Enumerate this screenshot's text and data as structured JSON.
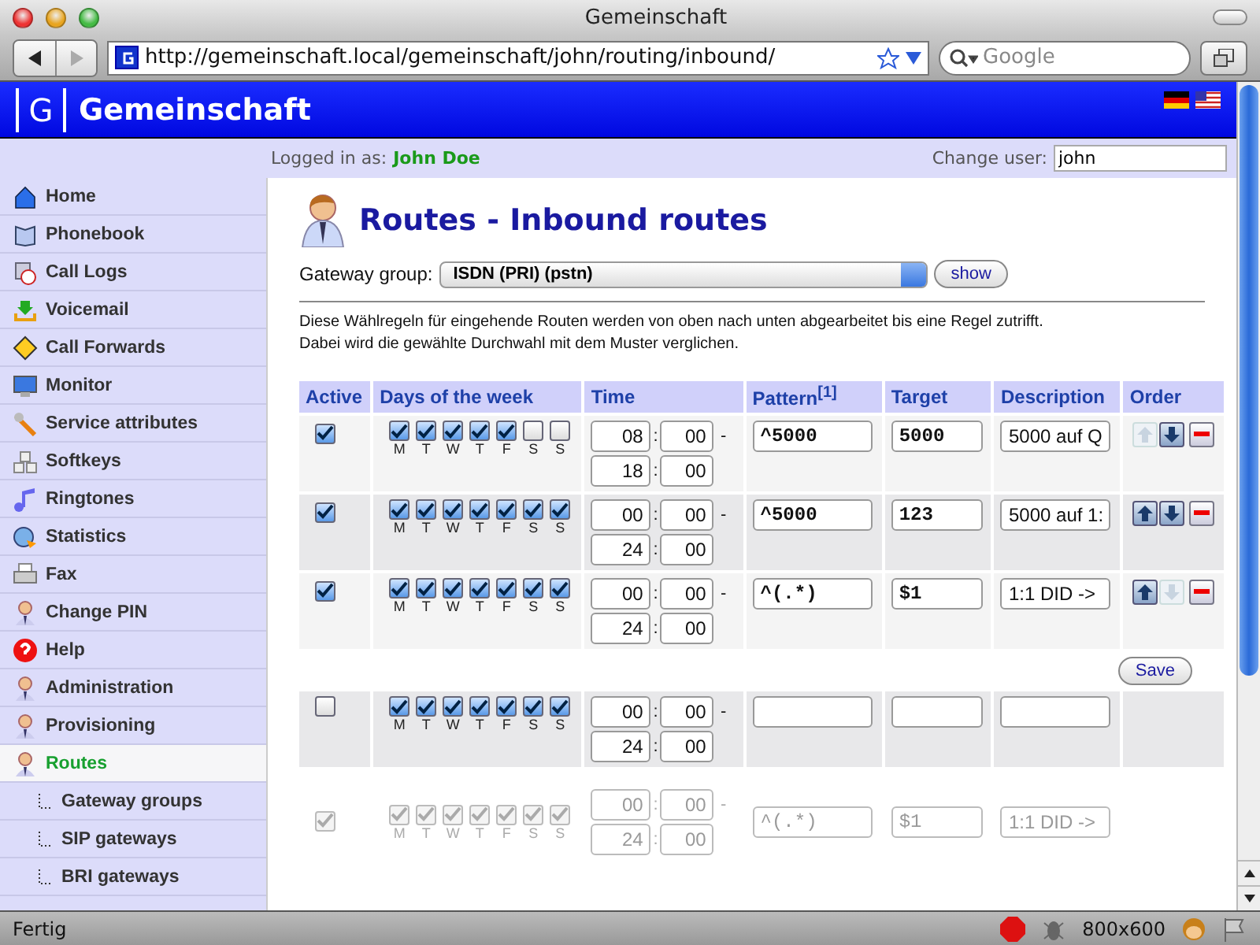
{
  "window": {
    "title": "Gemeinschaft"
  },
  "browser": {
    "url": "http://gemeinschaft.local/gemeinschaft/john/routing/inbound/",
    "search_placeholder": "Google",
    "status": "Fertig",
    "size": "800x600"
  },
  "header": {
    "logo_letter": "G",
    "brand": "Gemeinschaft"
  },
  "userbar": {
    "logged_label": "Logged in as:",
    "user": "John Doe",
    "change_label": "Change user:",
    "change_value": "john"
  },
  "sidebar": {
    "items": [
      {
        "label": "Home",
        "selected": false
      },
      {
        "label": "Phonebook",
        "selected": false
      },
      {
        "label": "Call Logs",
        "selected": false
      },
      {
        "label": "Voicemail",
        "selected": false
      },
      {
        "label": "Call Forwards",
        "selected": false
      },
      {
        "label": "Monitor",
        "selected": false
      },
      {
        "label": "Service attributes",
        "selected": false
      },
      {
        "label": "Softkeys",
        "selected": false
      },
      {
        "label": "Ringtones",
        "selected": false
      },
      {
        "label": "Statistics",
        "selected": false
      },
      {
        "label": "Fax",
        "selected": false
      },
      {
        "label": "Change PIN",
        "selected": false
      },
      {
        "label": "Help",
        "selected": false
      },
      {
        "label": "Administration",
        "selected": false
      },
      {
        "label": "Provisioning",
        "selected": false
      },
      {
        "label": "Routes",
        "selected": true,
        "children": [
          {
            "label": "Gateway groups",
            "selected": false
          },
          {
            "label": "SIP gateways",
            "selected": false
          },
          {
            "label": "BRI gateways",
            "selected": false
          }
        ]
      }
    ]
  },
  "page": {
    "title": "Routes - Inbound routes",
    "gateway_label": "Gateway group:",
    "gateway_value": "ISDN (PRI) (pstn)",
    "show_button": "show",
    "intro": [
      "Diese Wählregeln für eingehende Routen werden von oben nach unten abgearbeitet bis eine Regel zutrifft.",
      "Dabei wird die gewählte Durchwahl mit dem Muster verglichen."
    ],
    "save_button": "Save"
  },
  "table": {
    "columns": [
      "Active",
      "Days of the week",
      "Time",
      "Pattern$^{[1]}$",
      "Target",
      "Description",
      "Order"
    ],
    "rows": [
      {
        "kind": "route",
        "disabled": false,
        "active": true,
        "days": [
          {
            "label": "M",
            "checked": true
          },
          {
            "label": "T",
            "checked": true
          },
          {
            "label": "W",
            "checked": true
          },
          {
            "label": "T",
            "checked": true
          },
          {
            "label": "F",
            "checked": true
          },
          {
            "label": "S",
            "checked": false
          },
          {
            "label": "S",
            "checked": false
          }
        ],
        "from": [
          "08",
          "00"
        ],
        "to": [
          "18",
          "00"
        ],
        "colons": [
          ":",
          ":"
        ],
        "sep": "-",
        "pattern": "^5000",
        "target": "5000",
        "description": "5000 auf Q",
        "up_disabled": true,
        "down_disabled": false
      },
      {
        "kind": "route",
        "disabled": false,
        "active": true,
        "days": [
          {
            "label": "M",
            "checked": true
          },
          {
            "label": "T",
            "checked": true
          },
          {
            "label": "W",
            "checked": true
          },
          {
            "label": "T",
            "checked": true
          },
          {
            "label": "F",
            "checked": true
          },
          {
            "label": "S",
            "checked": true
          },
          {
            "label": "S",
            "checked": true
          }
        ],
        "from": [
          "00",
          "00"
        ],
        "to": [
          "24",
          "00"
        ],
        "colons": [
          ":",
          ":"
        ],
        "sep": "-",
        "pattern": "^5000",
        "target": "123",
        "description": "5000 auf 1:",
        "up_disabled": false,
        "down_disabled": false
      },
      {
        "kind": "route",
        "disabled": false,
        "active": true,
        "days": [
          {
            "label": "M",
            "checked": true
          },
          {
            "label": "T",
            "checked": true
          },
          {
            "label": "W",
            "checked": true
          },
          {
            "label": "T",
            "checked": true
          },
          {
            "label": "F",
            "checked": true
          },
          {
            "label": "S",
            "checked": true
          },
          {
            "label": "S",
            "checked": true
          }
        ],
        "from": [
          "00",
          "00"
        ],
        "to": [
          "24",
          "00"
        ],
        "colons": [
          ":",
          ":"
        ],
        "sep": "-",
        "pattern": "^(.*)",
        "target": "$1",
        "description": "1:1 DID ->",
        "up_disabled": false,
        "down_disabled": true
      },
      {
        "kind": "save"
      },
      {
        "kind": "new",
        "disabled": false,
        "active": false,
        "days": [
          {
            "label": "M",
            "checked": true
          },
          {
            "label": "T",
            "checked": true
          },
          {
            "label": "W",
            "checked": true
          },
          {
            "label": "T",
            "checked": true
          },
          {
            "label": "F",
            "checked": true
          },
          {
            "label": "S",
            "checked": true
          },
          {
            "label": "S",
            "checked": true
          }
        ],
        "from": [
          "00",
          "00"
        ],
        "to": [
          "24",
          "00"
        ],
        "colons": [
          ":",
          ":"
        ],
        "sep": "-"
      },
      {
        "kind": "default",
        "disabled": true,
        "active": true,
        "days": [
          {
            "label": "M",
            "checked": true
          },
          {
            "label": "T",
            "checked": true
          },
          {
            "label": "W",
            "checked": true
          },
          {
            "label": "T",
            "checked": true
          },
          {
            "label": "F",
            "checked": true
          },
          {
            "label": "S",
            "checked": true
          },
          {
            "label": "S",
            "checked": true
          }
        ],
        "from": [
          "00",
          "00"
        ],
        "to": [
          "24",
          "00"
        ],
        "colons": [
          ":",
          ":"
        ],
        "sep": "-",
        "pattern": "^(.*)",
        "target": "$1",
        "description": "1:1 DID ->"
      }
    ]
  }
}
